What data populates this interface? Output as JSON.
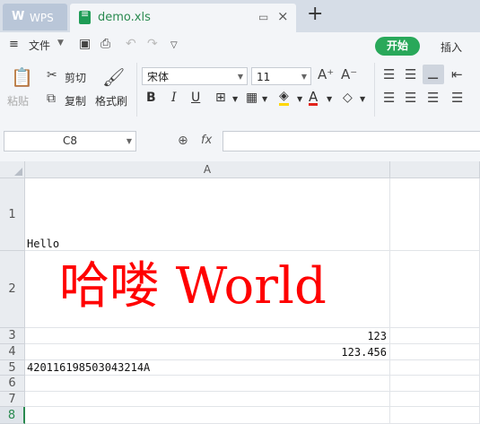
{
  "tabs": {
    "wps_logo": "W",
    "wps_label": "WPS",
    "doc_label": "demo.xls",
    "monitor_icon": "monitor-icon",
    "close_icon": "close-icon",
    "add_icon": "plus-icon"
  },
  "quickbar": {
    "file_menu": "文件",
    "start_tab": "开始",
    "insert_tab": "插入"
  },
  "ribbon": {
    "paste": "粘贴",
    "cut": "剪切",
    "copy": "复制",
    "format_painter": "格式刷",
    "font_name": "宋体",
    "font_size": "11",
    "bold": "B",
    "italic": "I",
    "underline": "U",
    "font_color": "A"
  },
  "formula_bar": {
    "name_box": "C8",
    "fx": "fx",
    "formula": ""
  },
  "sheet": {
    "column_headers": [
      "A"
    ],
    "row_headers": [
      "1",
      "2",
      "3",
      "4",
      "5",
      "6",
      "7",
      "8"
    ],
    "cells": {
      "A1": "Hello",
      "A2": "哈喽 World",
      "A3": "123",
      "A4": "123.456",
      "A5": "420116198503043214A"
    },
    "selected_row": "8"
  },
  "colors": {
    "accent": "#29a85a",
    "big_text": "#ff0000"
  }
}
